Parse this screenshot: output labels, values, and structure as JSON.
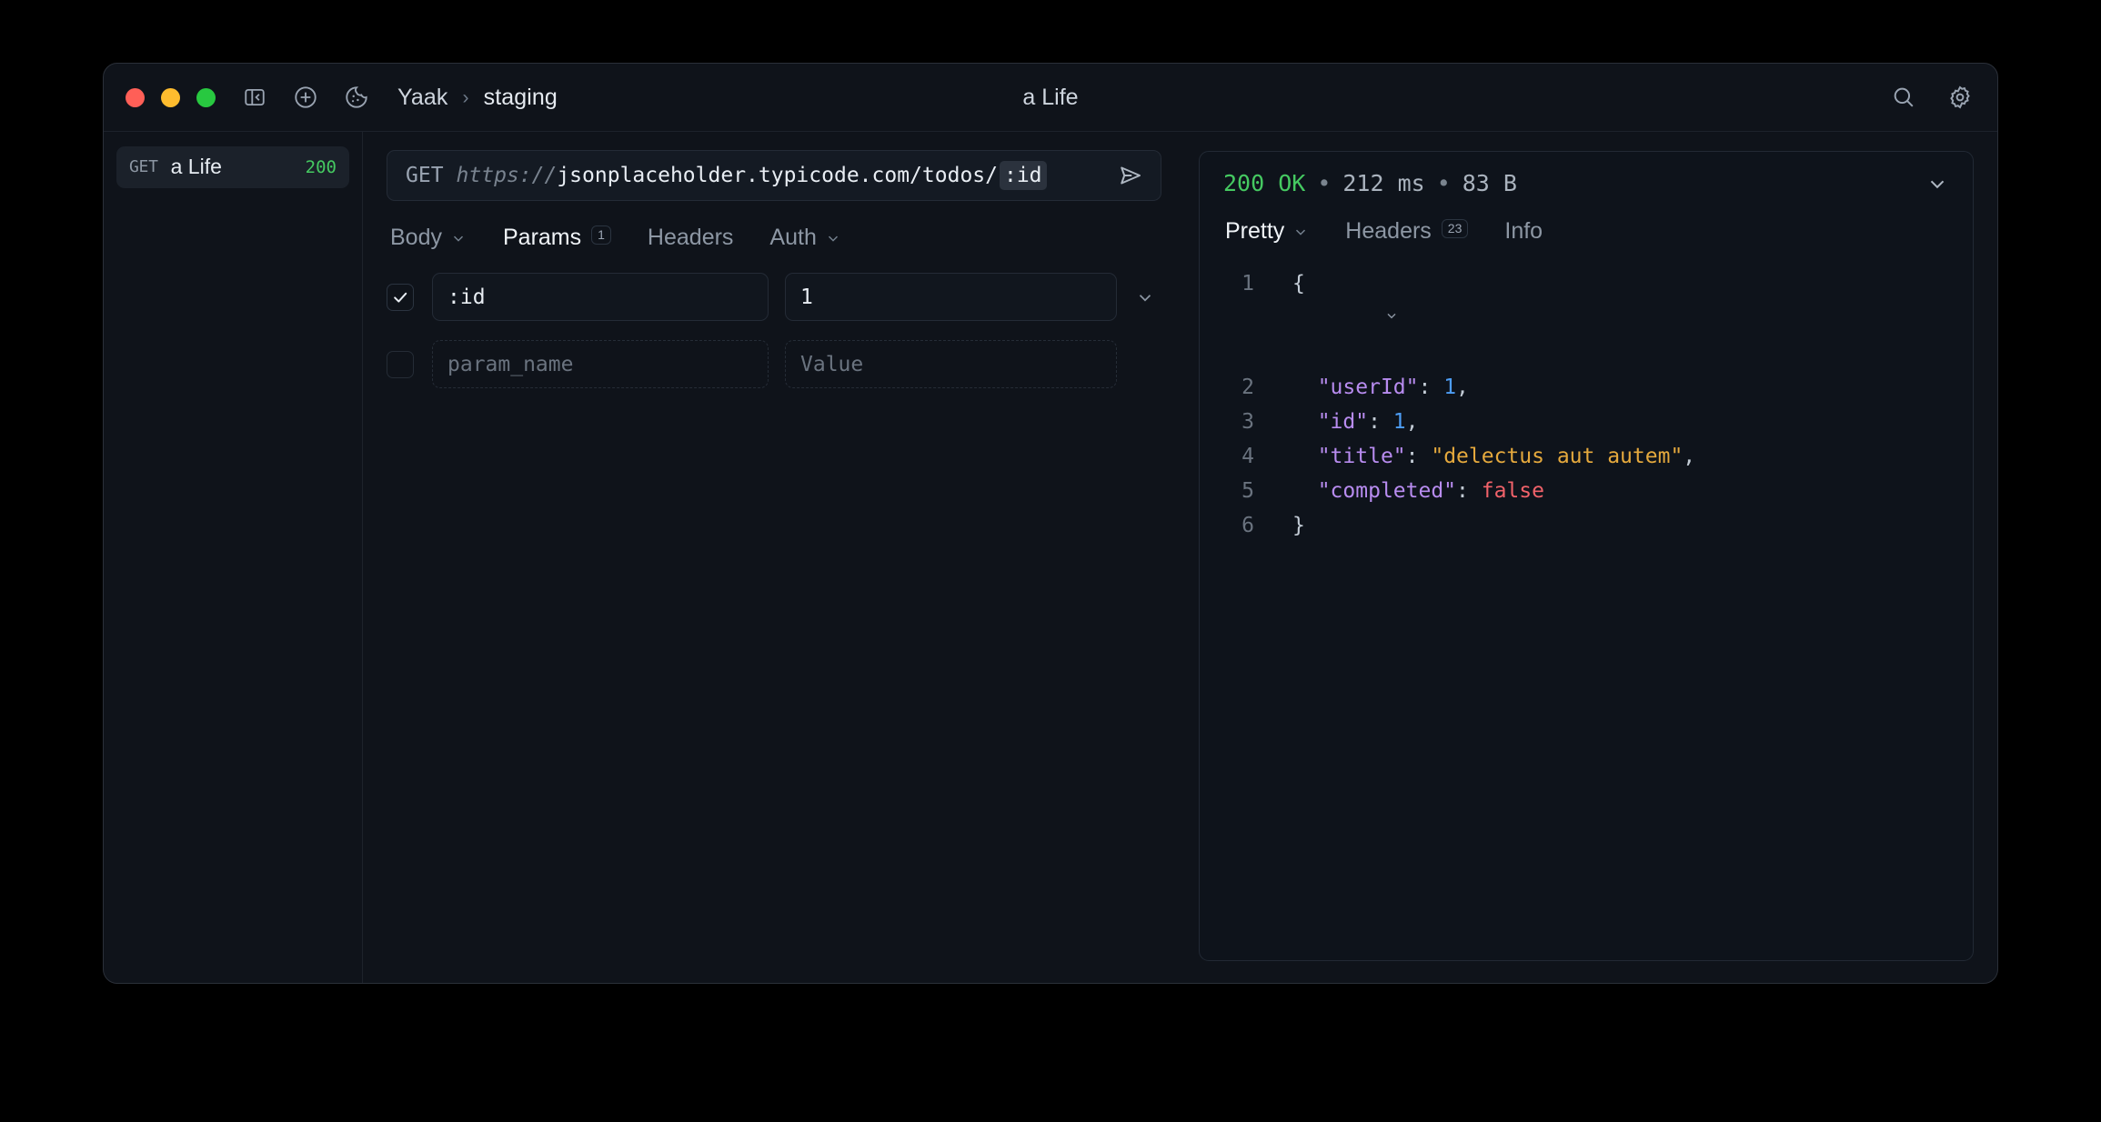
{
  "window": {
    "traffic_lights": [
      "close",
      "minimize",
      "zoom"
    ],
    "toolbar_icons": [
      "sidebar-toggle-icon",
      "add-icon",
      "cookie-icon"
    ],
    "breadcrumb": {
      "app": "Yaak",
      "separator": "›",
      "current": "staging"
    },
    "center_title": "a Life",
    "right_icons": [
      "search-icon",
      "settings-gear-icon"
    ]
  },
  "sidebar": {
    "items": [
      {
        "method": "GET",
        "name": "a Life",
        "status": "200"
      }
    ]
  },
  "request": {
    "url_bar": {
      "method": "GET",
      "scheme": "https://",
      "host_path": "jsonplaceholder.typicode.com/todos/",
      "variable_chip": ":id",
      "send_label": "send-icon"
    },
    "tabs": [
      {
        "label": "Body",
        "caret": "⌄",
        "active": false,
        "badge": ""
      },
      {
        "label": "Params",
        "caret": "",
        "active": true,
        "badge": "1"
      },
      {
        "label": "Headers",
        "caret": "",
        "active": false,
        "badge": ""
      },
      {
        "label": "Auth",
        "caret": "⌄",
        "active": false,
        "badge": ""
      }
    ],
    "params": [
      {
        "enabled": true,
        "name": ":id",
        "value": "1",
        "name_placeholder": "",
        "value_placeholder": ""
      },
      {
        "enabled": false,
        "name": "",
        "value": "",
        "name_placeholder": "param_name",
        "value_placeholder": "Value"
      }
    ]
  },
  "response": {
    "status_code": "200 OK",
    "dot": "•",
    "time": "212 ms",
    "size": "83 B",
    "tabs": [
      {
        "label": "Pretty",
        "caret": "⌄",
        "active": true,
        "badge": ""
      },
      {
        "label": "Headers",
        "caret": "",
        "active": false,
        "badge": "23"
      },
      {
        "label": "Info",
        "caret": "",
        "active": false,
        "badge": ""
      }
    ],
    "body_lines": [
      {
        "n": "1",
        "fold": "⌄"
      },
      {
        "n": "2",
        "fold": ""
      },
      {
        "n": "3",
        "fold": ""
      },
      {
        "n": "4",
        "fold": ""
      },
      {
        "n": "5",
        "fold": ""
      },
      {
        "n": "6",
        "fold": ""
      }
    ],
    "json": {
      "userId_key": "\"userId\"",
      "userId_val": "1",
      "id_key": "\"id\"",
      "id_val": "1",
      "title_key": "\"title\"",
      "title_val": "\"delectus aut autem\"",
      "completed_key": "\"completed\"",
      "completed_val": "false",
      "open_brace": "{",
      "close_brace": "}",
      "colon": ": ",
      "comma": ","
    }
  },
  "colors": {
    "accent_green": "#45c961",
    "string": "#e5a93d",
    "key": "#b88cf0",
    "number": "#4d9df5",
    "boolean": "#f0626a",
    "window_bg": "#0f131a"
  }
}
